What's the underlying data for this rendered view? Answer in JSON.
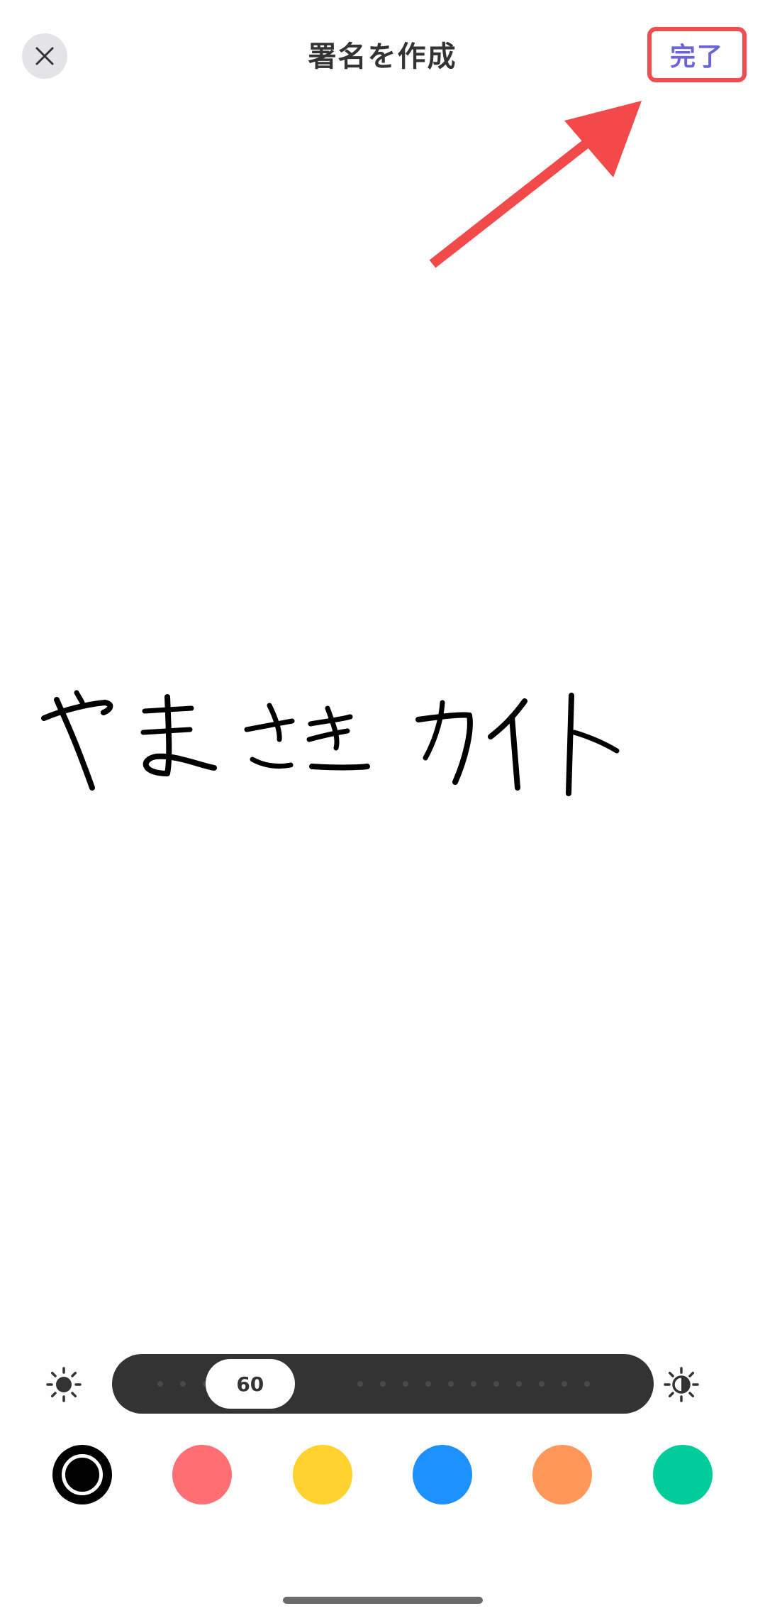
{
  "header": {
    "title": "署名を作成",
    "done_label": "完了",
    "close_icon": "close-icon",
    "highlight_color": "#ef4d4f",
    "done_color": "#6b63d9"
  },
  "annotation": {
    "arrow_icon": "pointer-arrow-icon",
    "arrow_color": "#f24a4a"
  },
  "canvas": {
    "signature_strokes": "やまさき カイト"
  },
  "toolbar": {
    "stroke_width": {
      "value": "60",
      "fraction": 0.2,
      "low_icon": "brightness-low-icon",
      "high_icon": "brightness-high-icon"
    },
    "colors": [
      {
        "name": "black",
        "hex": "#000000",
        "selected": true
      },
      {
        "name": "coral",
        "hex": "#ff6f73",
        "selected": false
      },
      {
        "name": "yellow",
        "hex": "#ffd22e",
        "selected": false
      },
      {
        "name": "blue",
        "hex": "#1e90ff",
        "selected": false
      },
      {
        "name": "orange",
        "hex": "#ff975a",
        "selected": false
      },
      {
        "name": "green",
        "hex": "#00cc99",
        "selected": false
      }
    ]
  }
}
